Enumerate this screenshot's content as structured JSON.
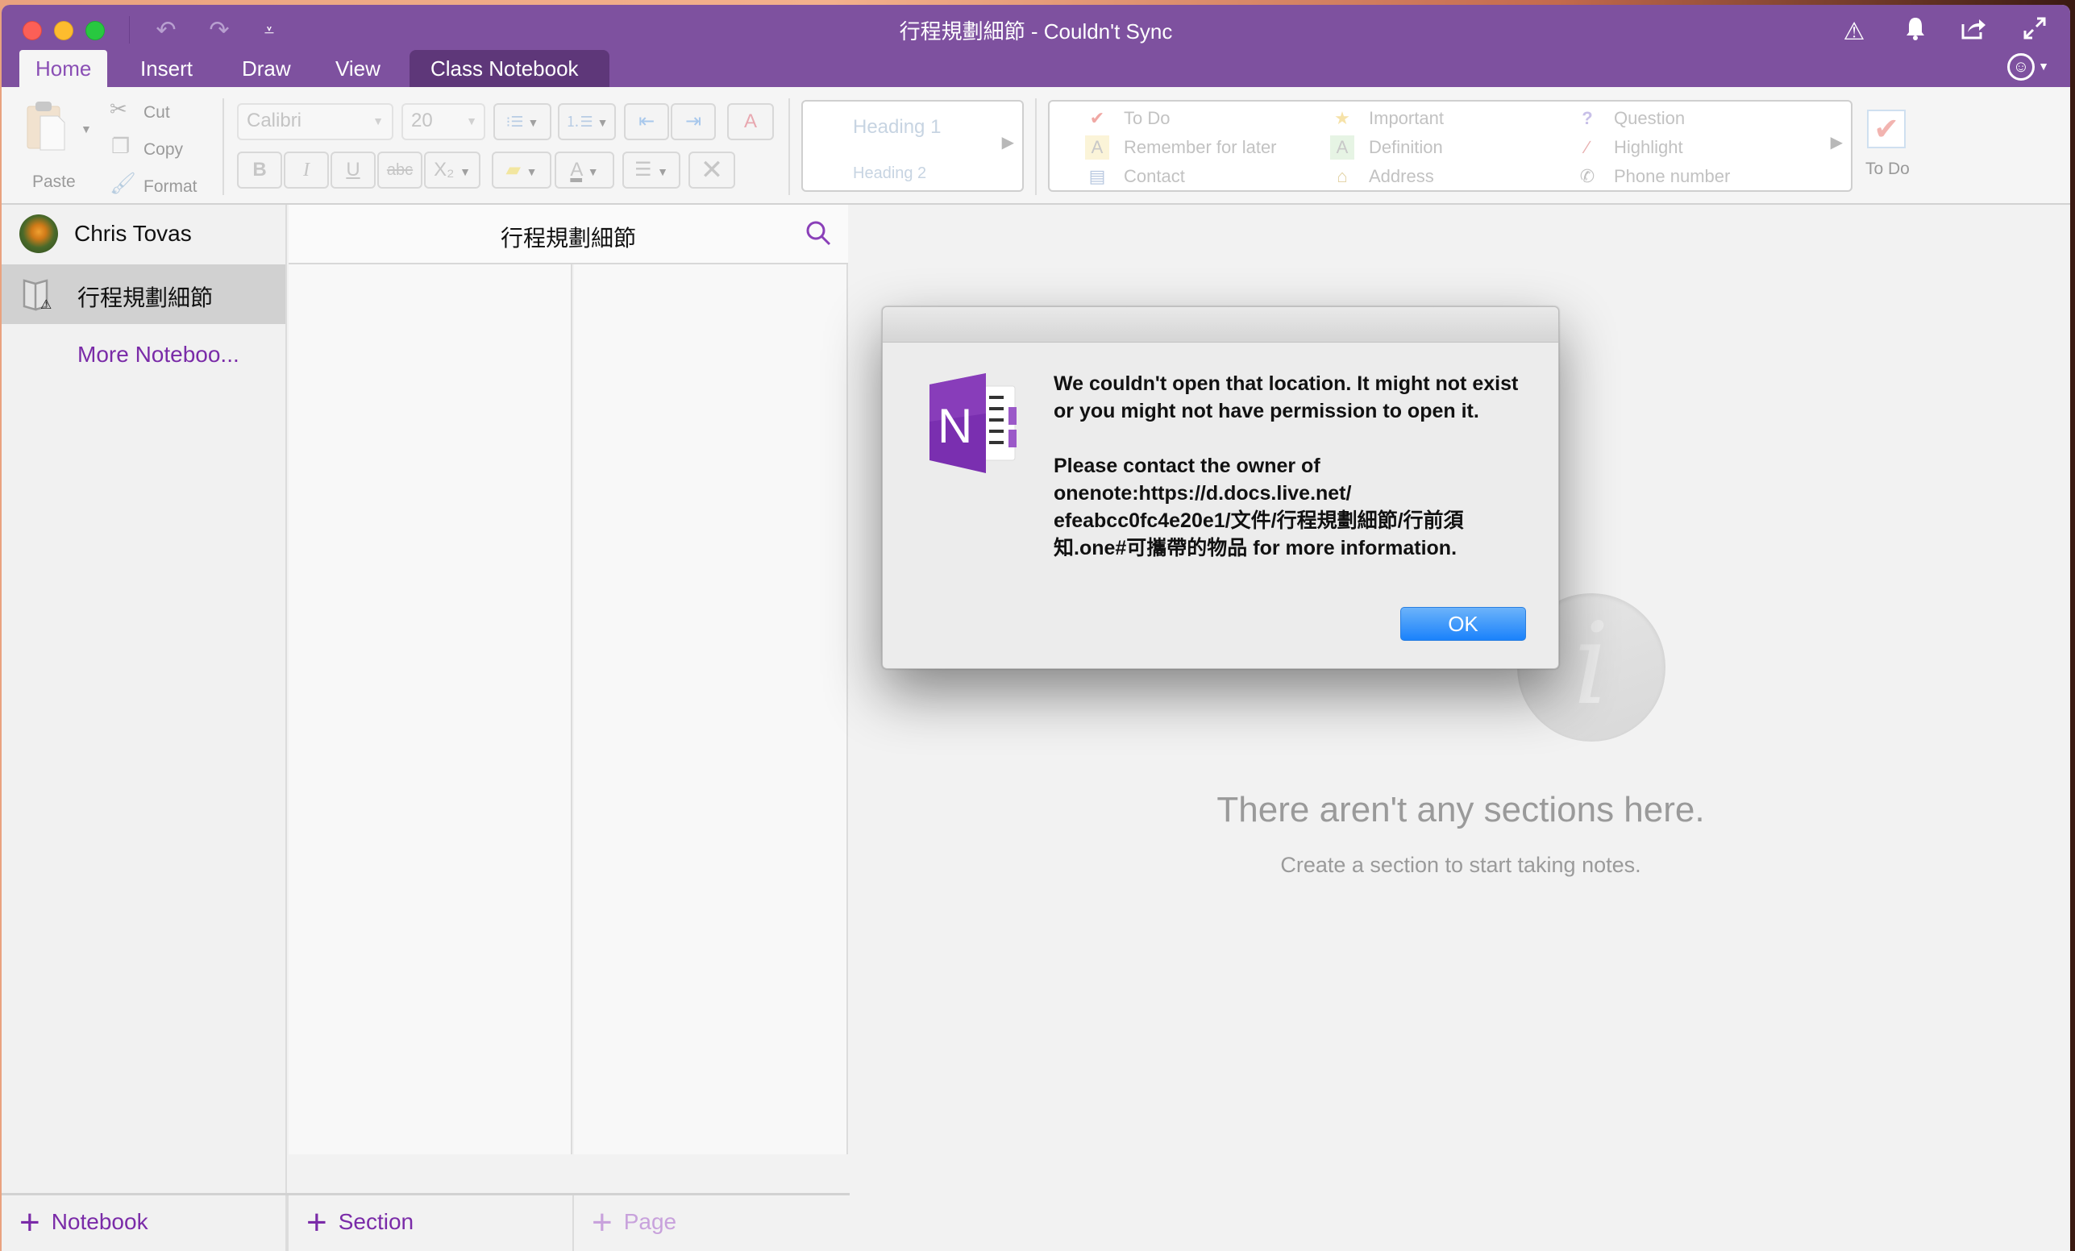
{
  "window": {
    "title": "行程規劃細節 - Couldn't Sync"
  },
  "titlebar_icons": {
    "undo": "↶",
    "redo": "↷",
    "customize": "⩡",
    "warning": "⚠",
    "bell": "🔔",
    "share": "⇗",
    "fullscreen": "⤢",
    "feedback": "☺"
  },
  "tabs": [
    {
      "label": "Home",
      "active": true
    },
    {
      "label": "Insert",
      "active": false
    },
    {
      "label": "Draw",
      "active": false
    },
    {
      "label": "View",
      "active": false
    },
    {
      "label": "Class Notebook",
      "active": false
    }
  ],
  "ribbon": {
    "paste_label": "Paste",
    "cut_label": "Cut",
    "copy_label": "Copy",
    "format_label": "Format",
    "font_name": "Calibri",
    "font_size": "20",
    "bold": "B",
    "italic": "I",
    "underline": "U",
    "strikethrough": "abc",
    "subscript": "X₂",
    "font_color": "A",
    "styles": {
      "heading1": "Heading 1",
      "heading2": "Heading 2"
    },
    "tags": [
      {
        "label": "To Do",
        "icon": "✔",
        "color": "#f0a8a4"
      },
      {
        "label": "Remember for later",
        "icon": "A",
        "color": "#d8c890"
      },
      {
        "label": "Contact",
        "icon": "▤",
        "color": "#b8c8e0"
      },
      {
        "label": "Important",
        "icon": "★",
        "color": "#f6e2a8"
      },
      {
        "label": "Definition",
        "icon": "A",
        "color": "#a8d0a8"
      },
      {
        "label": "Address",
        "icon": "⌂",
        "color": "#e8d8a8"
      },
      {
        "label": "Question",
        "icon": "?",
        "color": "#c8c0e8"
      },
      {
        "label": "Highlight",
        "icon": "∕",
        "color": "#e8b0b0"
      },
      {
        "label": "Phone number",
        "icon": "✆",
        "color": "#c0c0c0"
      }
    ],
    "todo_button_label": "To Do"
  },
  "sidebar": {
    "account_name": "Chris Tovas",
    "notebook_name": "行程規劃細節",
    "more_notebooks": "More Noteboo..."
  },
  "notebook_header": {
    "title": "行程規劃細節"
  },
  "bottom_bar": {
    "add_notebook": "Notebook",
    "add_section": "Section",
    "add_page": "Page"
  },
  "main": {
    "empty_title": "There aren't any sections here.",
    "empty_subtitle": "Create a section to start taking notes."
  },
  "dialog": {
    "message_1": "We couldn't open that location.  It might not exist or you might not have permission to open it.",
    "message_2": "Please contact the owner of onenote:https://d.docs.live.net/ efeabcc0fc4e20e1/文件/行程規劃細節/行前須知.one#可攜帶的物品 for more information.",
    "ok_label": "OK"
  },
  "colors": {
    "brand_purple": "#7e519f",
    "active_tab_text": "#8a4fb5",
    "class_notebook_tab": "#5e3779",
    "link_purple": "#7a2ba8",
    "ok_blue": "#1a82fb"
  }
}
